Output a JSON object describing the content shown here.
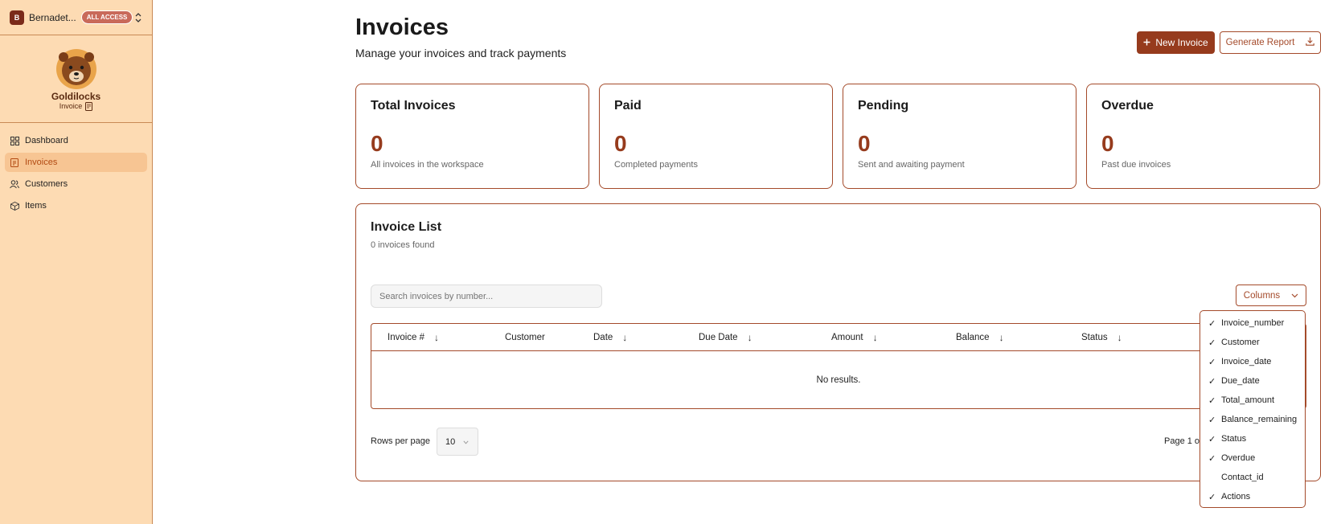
{
  "workspace": {
    "avatar_letter": "B",
    "name": "Bernadet...",
    "badge": "ALL ACCESS"
  },
  "logo": {
    "title": "Goldilocks",
    "subtitle": "Invoice"
  },
  "nav": [
    {
      "label": "Dashboard",
      "icon": "dashboard-icon",
      "active": false
    },
    {
      "label": "Invoices",
      "icon": "invoice-icon",
      "active": true
    },
    {
      "label": "Customers",
      "icon": "users-icon",
      "active": false
    },
    {
      "label": "Items",
      "icon": "box-icon",
      "active": false
    }
  ],
  "header": {
    "title": "Invoices",
    "subtitle": "Manage your invoices and track payments",
    "new_invoice": "New Invoice",
    "generate_report": "Generate Report"
  },
  "stats": [
    {
      "title": "Total Invoices",
      "value": "0",
      "desc": "All invoices in the workspace"
    },
    {
      "title": "Paid",
      "value": "0",
      "desc": "Completed payments"
    },
    {
      "title": "Pending",
      "value": "0",
      "desc": "Sent and awaiting payment"
    },
    {
      "title": "Overdue",
      "value": "0",
      "desc": "Past due invoices"
    }
  ],
  "invoice_list": {
    "title": "Invoice List",
    "count": "0 invoices found",
    "search_placeholder": "Search invoices by number...",
    "columns_button": "Columns",
    "headers": [
      {
        "label": "Invoice #",
        "sortable": true
      },
      {
        "label": "Customer",
        "sortable": false
      },
      {
        "label": "Date",
        "sortable": true
      },
      {
        "label": "Due Date",
        "sortable": true
      },
      {
        "label": "Amount",
        "sortable": true
      },
      {
        "label": "Balance",
        "sortable": true
      },
      {
        "label": "Status",
        "sortable": true
      }
    ],
    "empty_text": "No results.",
    "rows_per_page_label": "Rows per page",
    "rows_per_page_value": "10",
    "page_info": "Page 1 of"
  },
  "columns_menu": [
    {
      "label": "Invoice_number",
      "checked": true
    },
    {
      "label": "Customer",
      "checked": true
    },
    {
      "label": "Invoice_date",
      "checked": true
    },
    {
      "label": "Due_date",
      "checked": true
    },
    {
      "label": "Total_amount",
      "checked": true
    },
    {
      "label": "Balance_remaining",
      "checked": true
    },
    {
      "label": "Status",
      "checked": true
    },
    {
      "label": "Overdue",
      "checked": true
    },
    {
      "label": "Contact_id",
      "checked": false
    },
    {
      "label": "Actions",
      "checked": true
    }
  ],
  "colors": {
    "accent": "#963b1d",
    "sidebar_bg": "#fddbb3",
    "active_nav_bg": "#f7c593",
    "border": "#a44a2a"
  }
}
